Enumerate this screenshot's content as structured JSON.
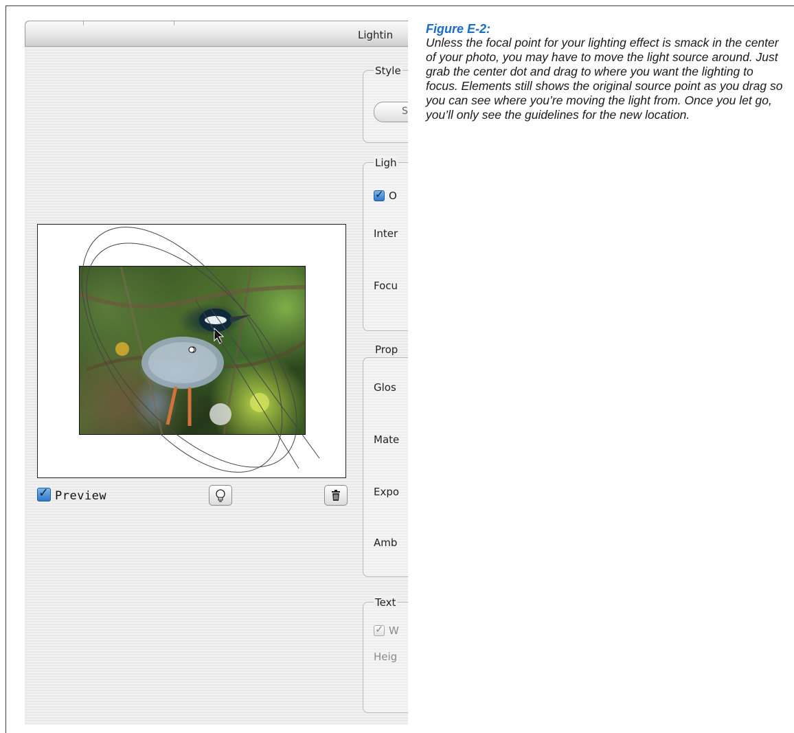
{
  "window": {
    "title": "Lightin"
  },
  "preview": {
    "checkbox_label": "Preview",
    "checked": true
  },
  "toolbar": {
    "light_icon": "lightbulb-icon",
    "delete_icon": "trash-icon"
  },
  "panel": {
    "style_group": {
      "title": "Style",
      "select_text": "S"
    },
    "light_group": {
      "title": "Ligh",
      "on_check": {
        "label": "O",
        "checked": true
      },
      "rows": [
        "Inter",
        "Focu"
      ]
    },
    "properties_group": {
      "title": "Prop",
      "rows": [
        "Glos",
        "Mate",
        "Expo",
        "Amb"
      ]
    },
    "texture_group": {
      "title": "Text",
      "white_check": {
        "label": "W",
        "checked": true,
        "disabled": true
      },
      "rows": [
        "Heig"
      ]
    }
  },
  "caption": {
    "title": "Figure E-2:",
    "body": "Unless the focal point for your lighting effect is smack in the center of your photo, you may have to move the light source around. Just grab the center dot and drag to where you want the lighting to focus. Elements still shows the original source point as you drag so you can see where you’re moving the light from. Once you let go, you’ll only see the guidelines for the new location."
  }
}
